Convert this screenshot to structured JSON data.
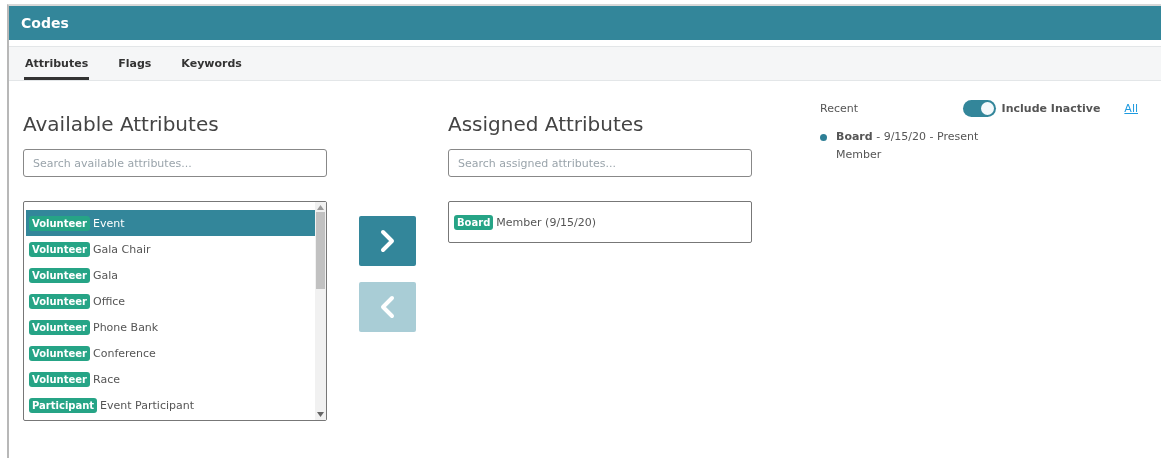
{
  "header": {
    "title": "Codes"
  },
  "tabs": [
    {
      "label": "Attributes",
      "selected": true
    },
    {
      "label": "Flags",
      "selected": false
    },
    {
      "label": "Keywords",
      "selected": false
    }
  ],
  "available": {
    "title": "Available Attributes",
    "search": {
      "placeholder": "Search available attributes..."
    },
    "items": [
      {
        "tag": "Volunteer",
        "label": "Event",
        "selected": true
      },
      {
        "tag": "Volunteer",
        "label": "Gala Chair",
        "selected": false
      },
      {
        "tag": "Volunteer",
        "label": "Gala",
        "selected": false
      },
      {
        "tag": "Volunteer",
        "label": "Office",
        "selected": false
      },
      {
        "tag": "Volunteer",
        "label": "Phone Bank",
        "selected": false
      },
      {
        "tag": "Volunteer",
        "label": "Conference",
        "selected": false
      },
      {
        "tag": "Volunteer",
        "label": "Race",
        "selected": false
      },
      {
        "tag": "Participant",
        "label": "Event Participant",
        "selected": false
      }
    ]
  },
  "move_buttons": [
    {
      "kind": "add",
      "disabled": false
    },
    {
      "kind": "remove",
      "disabled": true
    }
  ],
  "assigned": {
    "title": "Assigned Attributes",
    "search": {
      "placeholder": "Search assigned attributes..."
    },
    "items": [
      {
        "tag": "Board",
        "label": "Member (9/15/20)"
      }
    ]
  },
  "recent": {
    "label": "Recent",
    "include_inactive": {
      "label": "Include Inactive",
      "on": true
    },
    "all_link": "All",
    "entries": [
      {
        "line1": "**Board** - 9/15/20 - Present",
        "line2": "Member",
        "color": "#2e7f96"
      }
    ]
  }
}
